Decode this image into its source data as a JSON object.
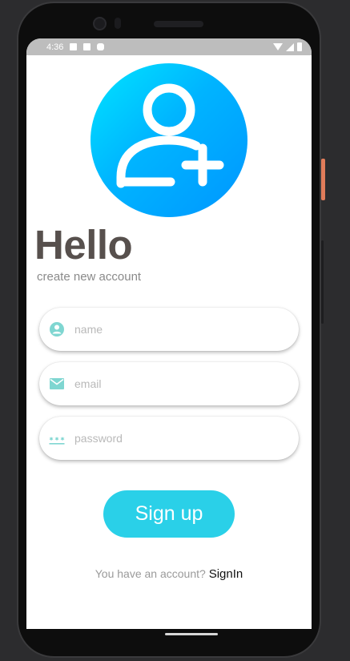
{
  "status_bar": {
    "time": "4:36"
  },
  "header": {
    "title": "Hello",
    "subtitle": "create new account"
  },
  "form": {
    "name": {
      "value": "",
      "placeholder": "name",
      "icon": "account-circle-icon"
    },
    "email": {
      "value": "",
      "placeholder": "email",
      "icon": "email-icon"
    },
    "password": {
      "value": "",
      "placeholder": "password",
      "icon": "password-icon"
    }
  },
  "actions": {
    "signup_label": "Sign up",
    "signin_prompt": "You have an account?",
    "signin_link": "SignIn"
  },
  "colors": {
    "accent": "#2ad0e8",
    "icon": "#7fd6d1",
    "title": "#57504d",
    "avatar_gradient_start": "#00e5ff",
    "avatar_gradient_end": "#0096ff"
  }
}
